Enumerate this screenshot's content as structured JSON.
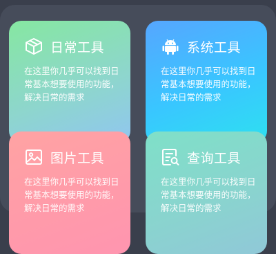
{
  "cards": [
    {
      "title": "日常工具",
      "desc": "在这里你几乎可以找到日常基本想要使用的功能，解决日常的需求",
      "icon": "cube-icon"
    },
    {
      "title": "系统工具",
      "desc": "在这里你几乎可以找到日常基本想要使用的功能，解决日常的需求",
      "icon": "android-icon"
    },
    {
      "title": "图片工具",
      "desc": "在这里你几乎可以找到日常基本想要使用的功能，解决日常的需求",
      "icon": "image-icon"
    },
    {
      "title": "查询工具",
      "desc": "在这里你几乎可以找到日常基本想要使用的功能，解决日常的需求",
      "icon": "search-doc-icon"
    }
  ]
}
